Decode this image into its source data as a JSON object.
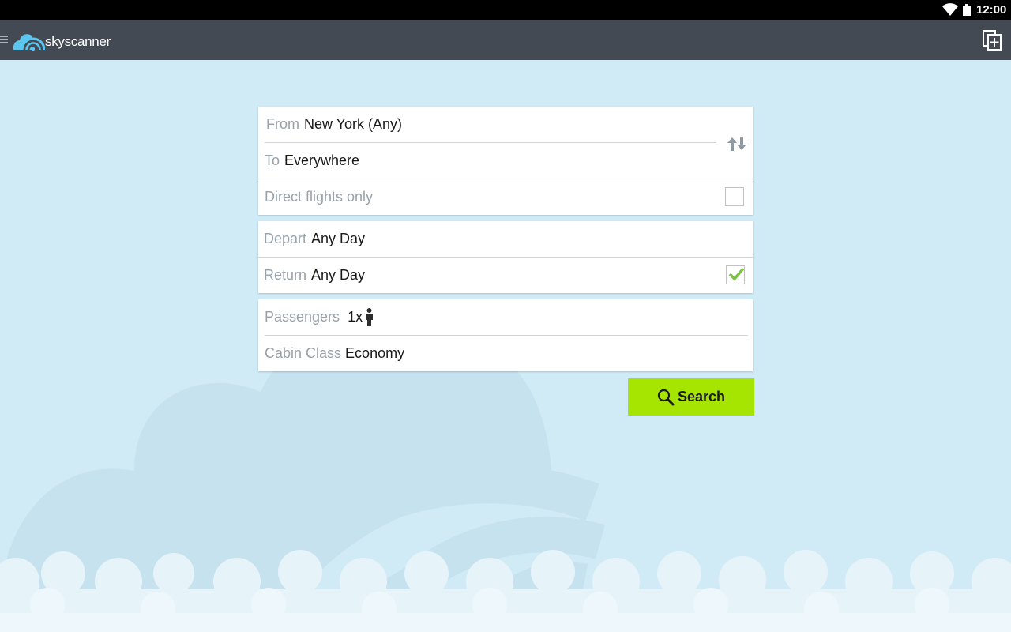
{
  "status_bar": {
    "time": "12:00"
  },
  "app_bar": {
    "brand": "skyscanner",
    "icons": {
      "menu": "hamburger-menu-icon",
      "logo": "skyscanner-cloud-logo-icon",
      "action": "add-document-icon"
    },
    "color": "#434a54"
  },
  "search_form": {
    "route": {
      "from_label": "From",
      "from_value": "New York (Any)",
      "to_label": "To",
      "to_value": "Everywhere",
      "swap_icon": "swap-arrows-icon",
      "direct_label": "Direct flights only",
      "direct_checked": false
    },
    "dates": {
      "depart_label": "Depart",
      "depart_value": "Any Day",
      "return_label": "Return",
      "return_value": "Any Day",
      "return_checked": true
    },
    "travellers": {
      "passengers_label": "Passengers",
      "passengers_value": "1x",
      "passenger_icon": "person-icon",
      "cabin_label": "Cabin Class",
      "cabin_value": "Economy"
    },
    "search_button": {
      "label": "Search",
      "icon": "search-icon",
      "color": "#a6e402"
    }
  },
  "colors": {
    "background": "#d1ebf6",
    "label": "#97a2a9",
    "check": "#7dc242"
  }
}
